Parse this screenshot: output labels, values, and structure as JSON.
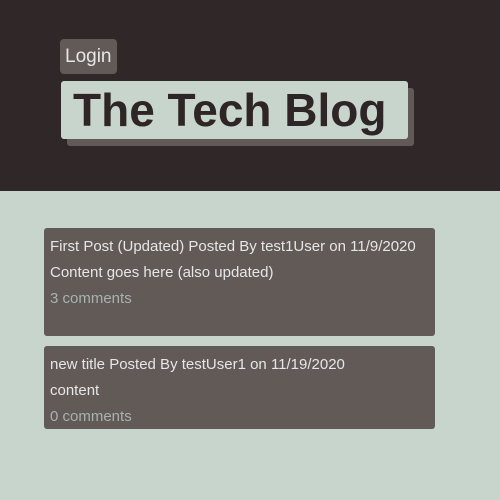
{
  "header": {
    "login_label": "Login",
    "title": "The Tech Blog"
  },
  "posts": [
    {
      "meta": "First Post (Updated) Posted By test1User on 11/9/2020",
      "content": "Content goes here (also updated)",
      "comments": "3 comments"
    },
    {
      "meta": "new title Posted By testUser1 on 11/19/2020",
      "content": "content",
      "comments": "0 comments"
    }
  ],
  "colors": {
    "header_bg": "#302828",
    "page_bg": "#c8d5cc",
    "card_bg": "#625a57",
    "text_light": "#e6e6e6",
    "link_muted": "#a8b2ae",
    "title_text": "#2e2626"
  }
}
